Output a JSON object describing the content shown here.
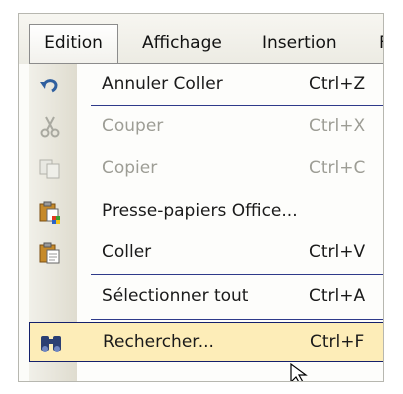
{
  "menubar": {
    "items": [
      {
        "label": "Edition",
        "active": true
      },
      {
        "label": "Affichage"
      },
      {
        "label": "Insertion"
      },
      {
        "label": "F"
      }
    ]
  },
  "menu": {
    "items": [
      {
        "label": "Annuler Coller",
        "shortcut": "Ctrl+Z",
        "icon": "undo-icon",
        "enabled": true
      },
      {
        "label": "Couper",
        "shortcut": "Ctrl+X",
        "icon": "cut-icon",
        "enabled": false
      },
      {
        "label": "Copier",
        "shortcut": "Ctrl+C",
        "icon": "copy-icon",
        "enabled": false
      },
      {
        "label": "Presse-papiers Office...",
        "shortcut": "",
        "icon": "clipboard-office-icon",
        "enabled": true
      },
      {
        "label": "Coller",
        "shortcut": "Ctrl+V",
        "icon": "paste-icon",
        "enabled": true
      },
      {
        "label": "Sélectionner tout",
        "shortcut": "Ctrl+A",
        "icon": "",
        "enabled": true
      },
      {
        "label": "Rechercher...",
        "shortcut": "Ctrl+F",
        "icon": "binoculars-icon",
        "enabled": true,
        "highlighted": true
      }
    ]
  },
  "colors": {
    "highlight_fill": "#fdedb8",
    "highlight_border": "#14206b",
    "separator": "#2f3a8a"
  }
}
